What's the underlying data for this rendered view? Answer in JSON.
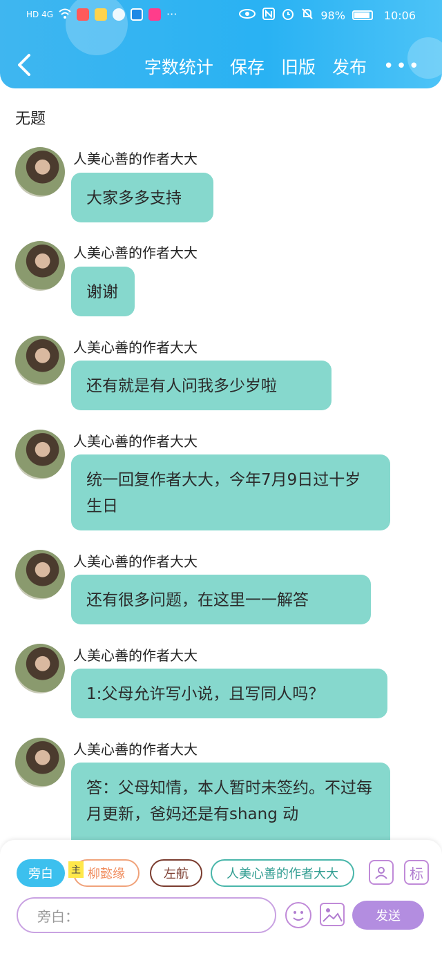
{
  "status_bar": {
    "left_text": "HD 4G",
    "battery": "98%",
    "time": "10:06"
  },
  "toolbar": {
    "word_count": "字数统计",
    "save": "保存",
    "old_version": "旧版",
    "publish": "发布",
    "more": "•••"
  },
  "doc_title": "无题",
  "messages": [
    {
      "author": "人美心善的作者大大",
      "text": "大家多多支持"
    },
    {
      "author": "人美心善的作者大大",
      "text": "谢谢"
    },
    {
      "author": "人美心善的作者大大",
      "text": "还有就是有人问我多少岁啦"
    },
    {
      "author": "人美心善的作者大大",
      "text": "统一回复作者大大，今年7月9日过十岁生日"
    },
    {
      "author": "人美心善的作者大大",
      "text": "还有很多问题，在这里一一解答"
    },
    {
      "author": "人美心善的作者大大",
      "text": "1:父母允许写小说，且写同人吗？"
    },
    {
      "author": "人美心善的作者大大",
      "text": "答：父母知情，本人暂时未签约。不过每月更新，爸妈还是有shang 动"
    }
  ],
  "roles": {
    "narration": "旁白",
    "main_tag": "主",
    "role2": "柳懿缘",
    "role3": "左航",
    "role4": "人美心善的作者大大",
    "mark_btn": "标"
  },
  "input": {
    "placeholder": "旁白：",
    "send": "发送"
  }
}
